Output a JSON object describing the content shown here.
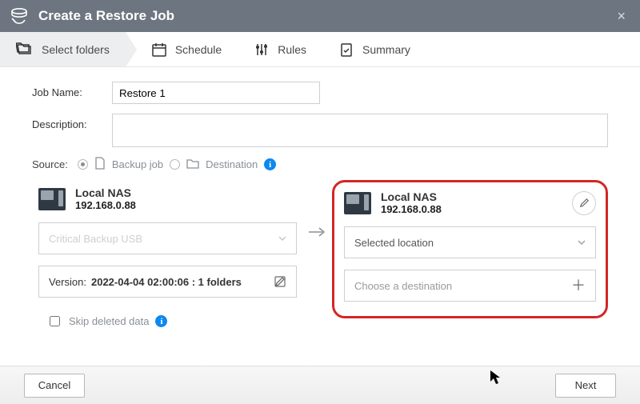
{
  "header": {
    "title": "Create a Restore Job"
  },
  "steps": [
    {
      "label": "Select folders",
      "active": true
    },
    {
      "label": "Schedule",
      "active": false
    },
    {
      "label": "Rules",
      "active": false
    },
    {
      "label": "Summary",
      "active": false
    }
  ],
  "form": {
    "job_name_label": "Job Name:",
    "job_name_value": "Restore 1",
    "description_label": "Description:",
    "description_value": ""
  },
  "source": {
    "label": "Source:",
    "backup_label": "Backup job",
    "destination_label": "Destination"
  },
  "left_panel": {
    "nas_name": "Local NAS",
    "nas_ip": "192.168.0.88",
    "backup_select_placeholder": "Critical Backup USB",
    "version_label": "Version:",
    "version_value": "2022-04-04 02:00:06 : 1 folders"
  },
  "right_panel": {
    "nas_name": "Local NAS",
    "nas_ip": "192.168.0.88",
    "location_label": "Selected location",
    "destination_placeholder": "Choose a destination"
  },
  "skip": {
    "label": "Skip deleted data"
  },
  "footer": {
    "cancel": "Cancel",
    "next": "Next"
  }
}
